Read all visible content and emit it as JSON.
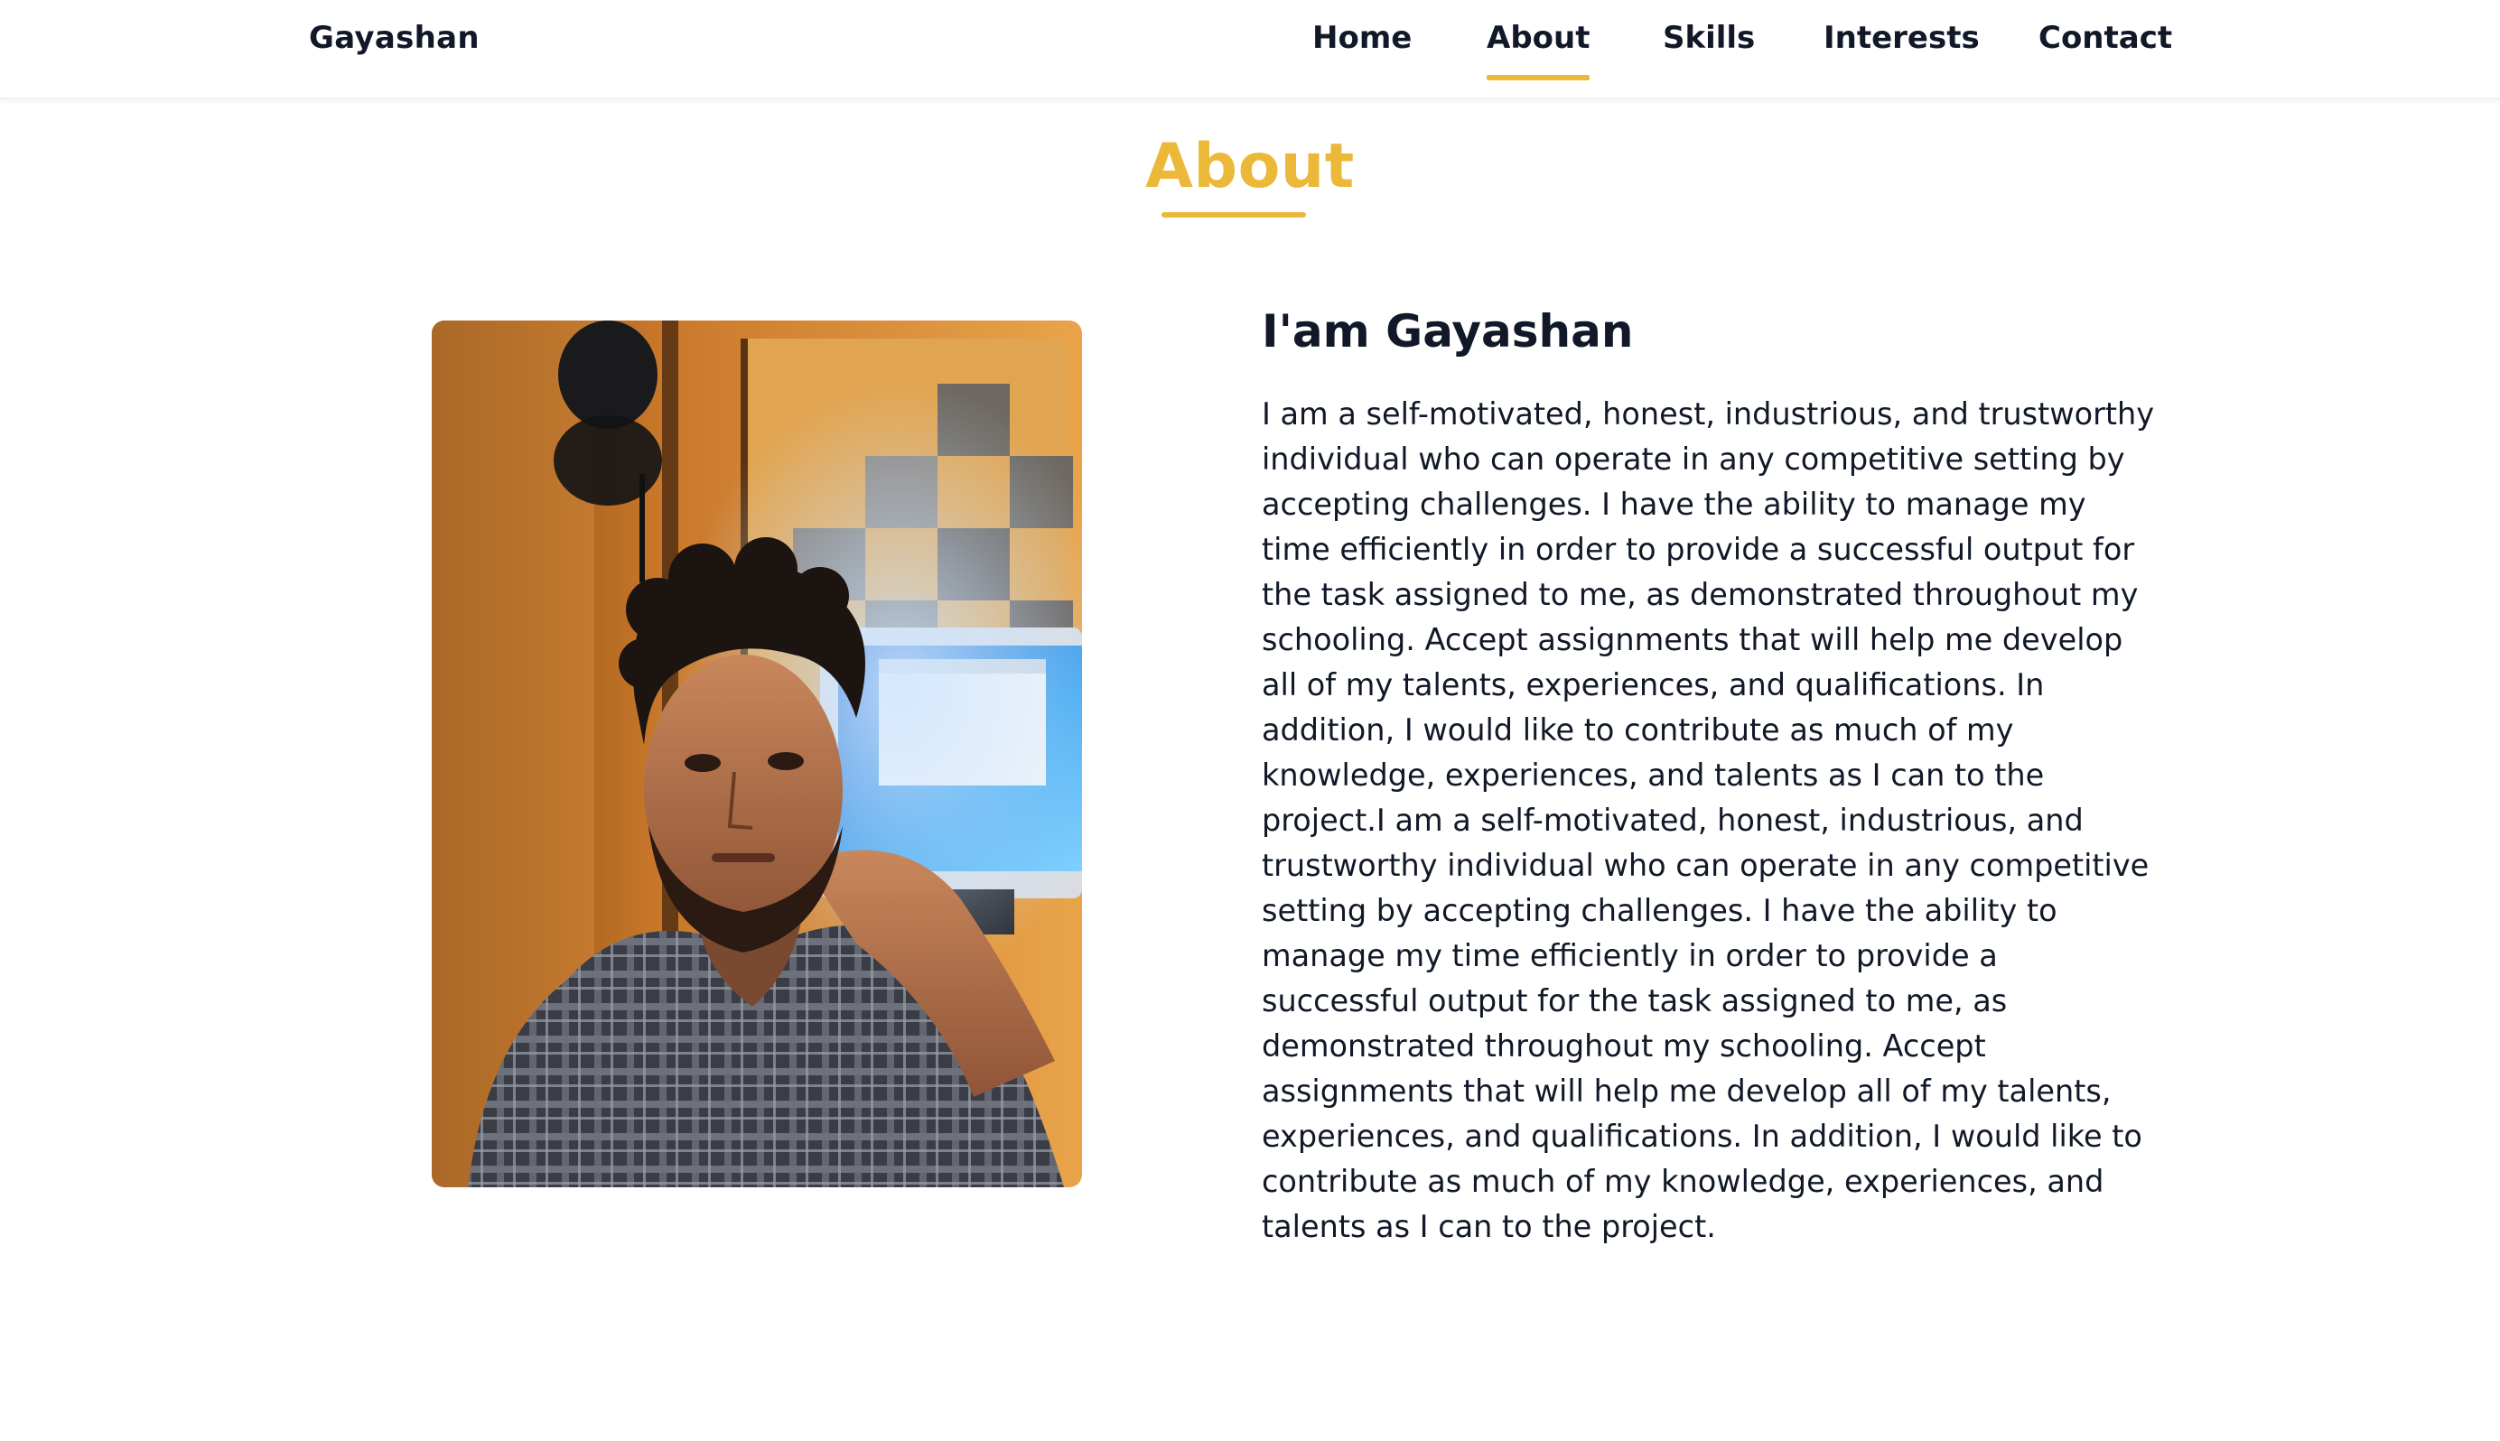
{
  "nav": {
    "brand": "Gayashan",
    "links": [
      {
        "label": "Home",
        "active": false
      },
      {
        "label": "About",
        "active": true
      },
      {
        "label": "Skills",
        "active": false
      },
      {
        "label": "Interests",
        "active": false
      },
      {
        "label": "Contact",
        "active": false
      }
    ]
  },
  "section": {
    "title": "About"
  },
  "about": {
    "heading": "I'am Gayashan",
    "paragraph": "I am a self-motivated, honest, industrious, and trustworthy individual who can operate in any competitive setting by accepting challenges. I have the ability to manage my time efficiently in order to provide a successful output for the task assigned to me, as demonstrated throughout my schooling. Accept assignments that will help me develop all of my talents, experiences, and qualifications. In addition, I would like to contribute as much of my knowledge, experiences, and talents as I can to the project.I am a self-motivated, honest, industrious, and trustworthy individual who can operate in any competitive setting by accepting challenges. I have the ability to manage my time efficiently in order to provide a successful output for the task assigned to me, as demonstrated throughout my schooling. Accept assignments that will help me develop all of my talents, experiences, and qualifications. In addition, I would like to contribute as much of my knowledge, experiences, and talents as I can to the project."
  },
  "colors": {
    "accent": "#ecb83a",
    "text": "#111827",
    "background": "#ffffff"
  }
}
